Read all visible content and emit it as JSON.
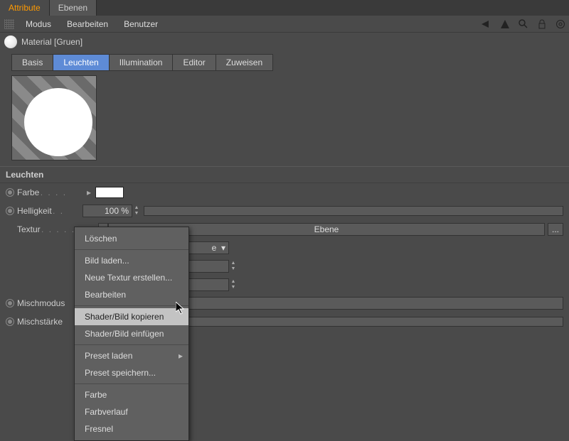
{
  "topTabs": {
    "attribute": "Attribute",
    "ebenen": "Ebenen"
  },
  "menus": {
    "modus": "Modus",
    "bearbeiten": "Bearbeiten",
    "benutzer": "Benutzer"
  },
  "material": {
    "title": "Material [Gruen]"
  },
  "catTabs": {
    "basis": "Basis",
    "leuchten": "Leuchten",
    "illumination": "Illumination",
    "editor": "Editor",
    "zuweisen": "Zuweisen"
  },
  "section": {
    "heading": "Leuchten"
  },
  "params": {
    "farbe": {
      "label": "Farbe"
    },
    "helligkeit": {
      "label": "Helligkeit",
      "value": "100 %"
    },
    "textur": {
      "label": "Textur",
      "dropdown": "Ebene",
      "sub1": "e"
    },
    "mischmodus": {
      "label": "Mischmodus"
    },
    "mischstaerke": {
      "label": "Mischstärke"
    }
  },
  "ctx": {
    "loeschen": "Löschen",
    "bildladen": "Bild laden...",
    "neuetextur": "Neue Textur erstellen...",
    "bearbeiten": "Bearbeiten",
    "shaderkopieren": "Shader/Bild kopieren",
    "shadereinf": "Shader/Bild einfügen",
    "presetladen": "Preset laden",
    "presetspeichern": "Preset speichern...",
    "farbe": "Farbe",
    "farbverlauf": "Farbverlauf",
    "fresnel": "Fresnel"
  },
  "misc": {
    "ellipsis": "..."
  }
}
